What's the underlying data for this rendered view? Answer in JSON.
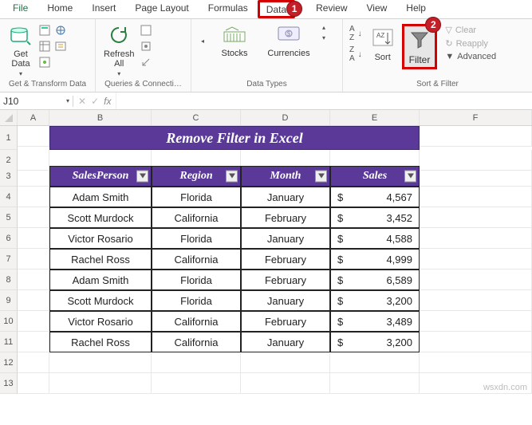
{
  "tabs": {
    "file": "File",
    "home": "Home",
    "insert": "Insert",
    "page_layout": "Page Layout",
    "formulas": "Formulas",
    "data": "Data",
    "review": "Review",
    "view": "View",
    "help": "Help"
  },
  "ribbon": {
    "get_data": "Get\nData",
    "refresh_all": "Refresh\nAll",
    "group1": "Get & Transform Data",
    "group2": "Queries & Connecti…",
    "stocks": "Stocks",
    "currencies": "Currencies",
    "group3": "Data Types",
    "sort_az": "A→Z",
    "sort_za": "Z→A",
    "sort": "Sort",
    "filter": "Filter",
    "clear": "Clear",
    "reapply": "Reapply",
    "advanced": "Advanced",
    "group4": "Sort & Filter"
  },
  "markers": {
    "one": "1",
    "two": "2"
  },
  "namebox": "J10",
  "fx": "fx",
  "columns": {
    "a": "A",
    "b": "B",
    "c": "C",
    "d": "D",
    "e": "E",
    "f": "F"
  },
  "rows": [
    "1",
    "2",
    "3",
    "4",
    "5",
    "6",
    "7",
    "8",
    "9",
    "10",
    "11",
    "12",
    "13"
  ],
  "title": "Remove Filter in Excel",
  "headers": {
    "sp": "SalesPerson",
    "region": "Region",
    "month": "Month",
    "sales": "Sales"
  },
  "data": [
    {
      "sp": "Adam Smith",
      "region": "Florida",
      "month": "January",
      "cur": "$",
      "sales": "4,567"
    },
    {
      "sp": "Scott Murdock",
      "region": "California",
      "month": "February",
      "cur": "$",
      "sales": "3,452"
    },
    {
      "sp": "Victor Rosario",
      "region": "Florida",
      "month": "January",
      "cur": "$",
      "sales": "4,588"
    },
    {
      "sp": "Rachel Ross",
      "region": "California",
      "month": "February",
      "cur": "$",
      "sales": "4,999"
    },
    {
      "sp": "Adam Smith",
      "region": "Florida",
      "month": "February",
      "cur": "$",
      "sales": "6,589"
    },
    {
      "sp": "Scott Murdock",
      "region": "Florida",
      "month": "January",
      "cur": "$",
      "sales": "3,200"
    },
    {
      "sp": "Victor Rosario",
      "region": "California",
      "month": "February",
      "cur": "$",
      "sales": "3,489"
    },
    {
      "sp": "Rachel Ross",
      "region": "California",
      "month": "January",
      "cur": "$",
      "sales": "3,200"
    }
  ],
  "watermark": "wsxdn.com"
}
